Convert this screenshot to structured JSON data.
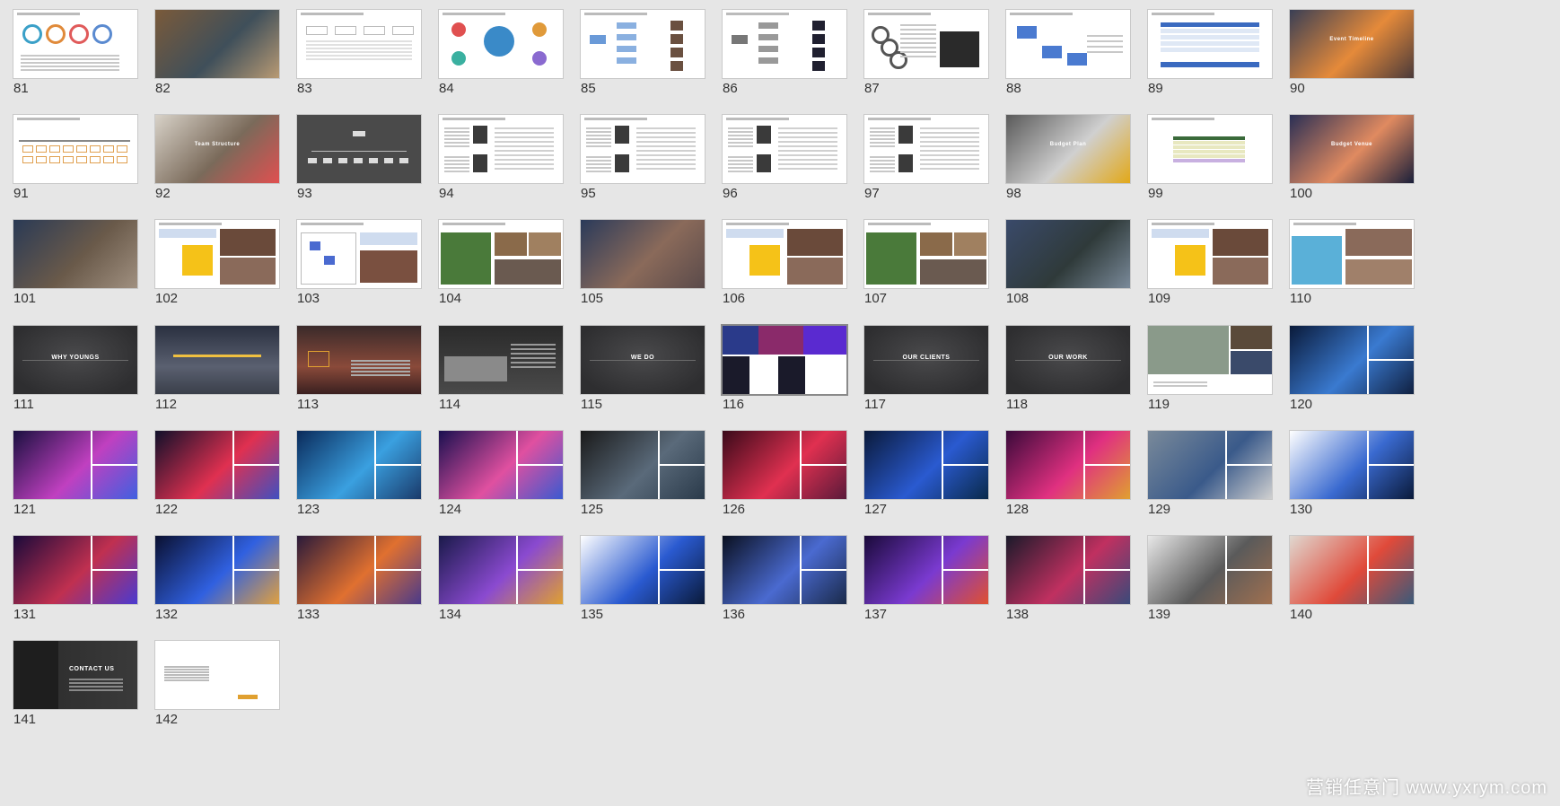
{
  "watermark": "营销任意门 www.yxrym.com",
  "selected_slide": 116,
  "slides": [
    {
      "n": "81",
      "style": "white",
      "variant": "circles"
    },
    {
      "n": "82",
      "style": "photo",
      "colors": [
        "#7a5a3a",
        "#3f4f5a",
        "#b89a74"
      ]
    },
    {
      "n": "83",
      "style": "white",
      "variant": "org"
    },
    {
      "n": "84",
      "style": "white",
      "variant": "wheel"
    },
    {
      "n": "85",
      "style": "white",
      "variant": "tree-photos"
    },
    {
      "n": "86",
      "style": "white",
      "variant": "tree-photos-dark"
    },
    {
      "n": "87",
      "style": "white",
      "variant": "gears"
    },
    {
      "n": "88",
      "style": "white",
      "variant": "flow-blue"
    },
    {
      "n": "89",
      "style": "white",
      "variant": "table-blue"
    },
    {
      "n": "90",
      "style": "photo",
      "colors": [
        "#3a3f55",
        "#e58a3a",
        "#4a3a3a"
      ],
      "caption": "Event Timeline"
    },
    {
      "n": "91",
      "style": "white",
      "variant": "timeline"
    },
    {
      "n": "92",
      "style": "photo",
      "colors": [
        "#d8d2c8",
        "#7a6a5a",
        "#e05050"
      ],
      "caption": "Team Structure"
    },
    {
      "n": "93",
      "style": "dark",
      "variant": "org-dark"
    },
    {
      "n": "94",
      "style": "white",
      "variant": "profiles"
    },
    {
      "n": "95",
      "style": "white",
      "variant": "profiles"
    },
    {
      "n": "96",
      "style": "white",
      "variant": "profiles"
    },
    {
      "n": "97",
      "style": "white",
      "variant": "profiles"
    },
    {
      "n": "98",
      "style": "photo",
      "colors": [
        "#5a5a5a",
        "#d0d0d0",
        "#e2a818"
      ],
      "caption": "Budget Plan"
    },
    {
      "n": "99",
      "style": "white",
      "variant": "budget-table"
    },
    {
      "n": "100",
      "style": "photo",
      "colors": [
        "#2a2f55",
        "#e08a60",
        "#1a1f3a"
      ],
      "caption": "Budget Venue"
    },
    {
      "n": "101",
      "style": "photo",
      "colors": [
        "#2a3a55",
        "#6a5a4a",
        "#a09080"
      ]
    },
    {
      "n": "102",
      "style": "white",
      "variant": "venue-yellow"
    },
    {
      "n": "103",
      "style": "white",
      "variant": "venue-plan"
    },
    {
      "n": "104",
      "style": "white",
      "variant": "venue-green"
    },
    {
      "n": "105",
      "style": "photo",
      "colors": [
        "#2a3a5a",
        "#8a6a5a",
        "#5a4a4a"
      ]
    },
    {
      "n": "106",
      "style": "white",
      "variant": "venue-yellow"
    },
    {
      "n": "107",
      "style": "white",
      "variant": "venue-green"
    },
    {
      "n": "108",
      "style": "photo",
      "colors": [
        "#3a4a6a",
        "#2f3a3a",
        "#7a8a9a"
      ]
    },
    {
      "n": "109",
      "style": "white",
      "variant": "venue-yellow"
    },
    {
      "n": "110",
      "style": "white",
      "variant": "venue-pool"
    },
    {
      "n": "111",
      "style": "dark",
      "variant": "section",
      "label": "WHY YOUNGS"
    },
    {
      "n": "112",
      "style": "dark",
      "variant": "quote"
    },
    {
      "n": "113",
      "style": "dark",
      "variant": "canyon"
    },
    {
      "n": "114",
      "style": "dark",
      "variant": "car"
    },
    {
      "n": "115",
      "style": "dark",
      "variant": "section",
      "label": "WE DO"
    },
    {
      "n": "116",
      "style": "dark",
      "variant": "stage-mix"
    },
    {
      "n": "117",
      "style": "dark",
      "variant": "section",
      "label": "OUR CLIENTS"
    },
    {
      "n": "118",
      "style": "dark",
      "variant": "section",
      "label": "OUR WORK"
    },
    {
      "n": "119",
      "style": "white",
      "variant": "car-collage"
    },
    {
      "n": "120",
      "style": "photo",
      "colors": [
        "#0a1a3a",
        "#3a7ad0",
        "#102040"
      ]
    },
    {
      "n": "121",
      "style": "photo",
      "colors": [
        "#1a1040",
        "#c040c0",
        "#4060e0"
      ]
    },
    {
      "n": "122",
      "style": "photo",
      "colors": [
        "#10102a",
        "#e03050",
        "#4050c0"
      ]
    },
    {
      "n": "123",
      "style": "photo",
      "colors": [
        "#0a2a5a",
        "#3aa0e0",
        "#1a3a6a"
      ]
    },
    {
      "n": "124",
      "style": "photo",
      "colors": [
        "#1a1050",
        "#e050a0",
        "#3a5ad0"
      ]
    },
    {
      "n": "125",
      "style": "photo",
      "colors": [
        "#1a1a1a",
        "#5a6a7a",
        "#2a3a4a"
      ]
    },
    {
      "n": "126",
      "style": "photo",
      "colors": [
        "#3a0a1a",
        "#e03050",
        "#5a1a3a"
      ]
    },
    {
      "n": "127",
      "style": "photo",
      "colors": [
        "#0a1a3a",
        "#2a5ad0",
        "#0a2a4a"
      ]
    },
    {
      "n": "128",
      "style": "photo",
      "colors": [
        "#3a0a3a",
        "#e03080",
        "#e0a030"
      ]
    },
    {
      "n": "129",
      "style": "photo",
      "colors": [
        "#7a8a9a",
        "#3a5a8a",
        "#d0d0d0"
      ]
    },
    {
      "n": "130",
      "style": "photo",
      "colors": [
        "#ffffff",
        "#3a6ad0",
        "#0a1a3a"
      ]
    },
    {
      "n": "131",
      "style": "photo",
      "colors": [
        "#1a0a3a",
        "#c03050",
        "#4a3ad0"
      ]
    },
    {
      "n": "132",
      "style": "photo",
      "colors": [
        "#0a1030",
        "#3060e0",
        "#e0a040"
      ]
    },
    {
      "n": "133",
      "style": "photo",
      "colors": [
        "#2a1a3a",
        "#e07030",
        "#4a3a8a"
      ]
    },
    {
      "n": "134",
      "style": "photo",
      "colors": [
        "#1a1a4a",
        "#8a4ad0",
        "#e0a030"
      ]
    },
    {
      "n": "135",
      "style": "photo",
      "colors": [
        "#ffffff",
        "#2a5ad0",
        "#0a1a3a"
      ]
    },
    {
      "n": "136",
      "style": "photo",
      "colors": [
        "#0a1020",
        "#4a6ad0",
        "#1a2a4a"
      ]
    },
    {
      "n": "137",
      "style": "photo",
      "colors": [
        "#1a0a3a",
        "#7a3ad0",
        "#e05030"
      ]
    },
    {
      "n": "138",
      "style": "photo",
      "colors": [
        "#1a1a2a",
        "#c03060",
        "#3a4a7a"
      ]
    },
    {
      "n": "139",
      "style": "photo",
      "colors": [
        "#e8e8e8",
        "#5a5a5a",
        "#a07050"
      ]
    },
    {
      "n": "140",
      "style": "photo",
      "colors": [
        "#e0d8d0",
        "#e04a3a",
        "#3a5a7a"
      ]
    },
    {
      "n": "141",
      "style": "dark",
      "variant": "contact",
      "label": "CONTACT US"
    },
    {
      "n": "142",
      "style": "white",
      "variant": "end"
    }
  ]
}
